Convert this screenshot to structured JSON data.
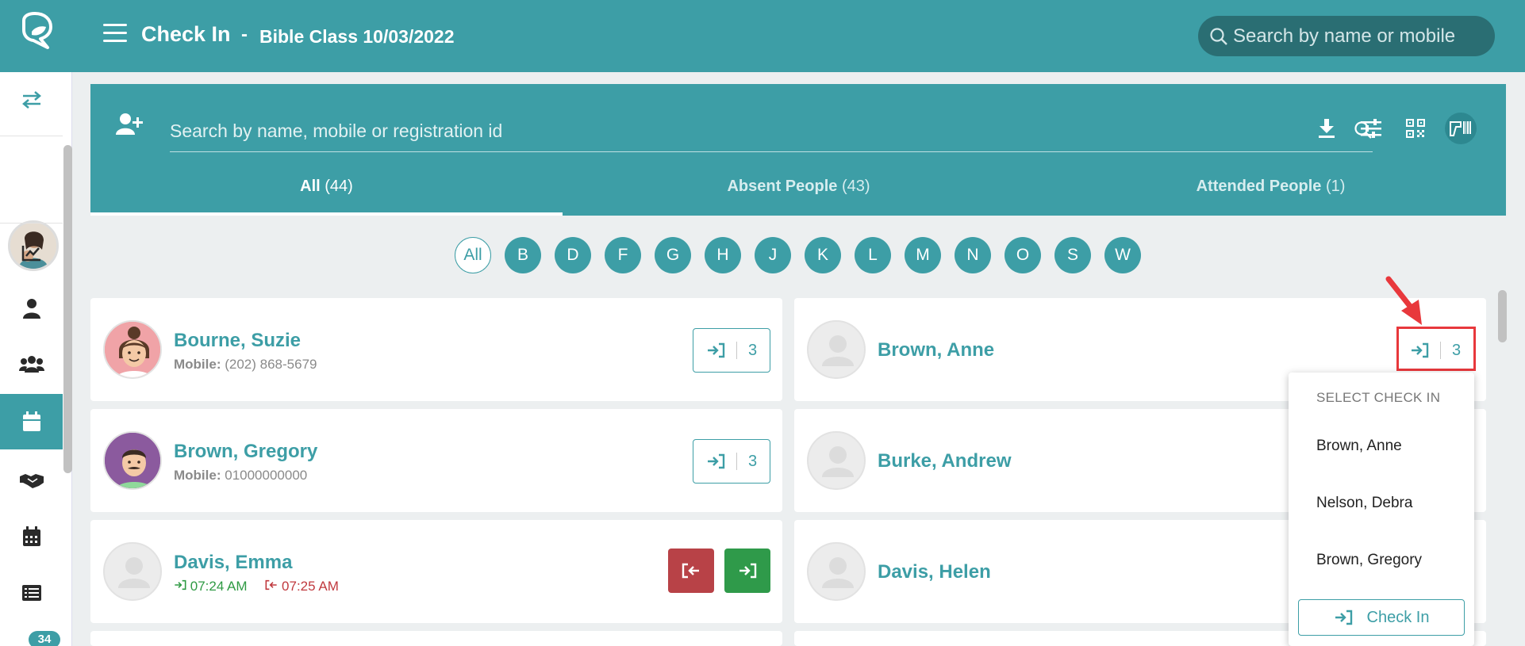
{
  "header": {
    "title": "Check In",
    "separator": "-",
    "subtitle": "Bible Class 10/03/2022",
    "search_placeholder": "Search by name or mobile"
  },
  "sidebar": {
    "items": [
      {
        "name": "swap-icon"
      },
      {
        "name": "chart-icon"
      },
      {
        "name": "person-icon"
      },
      {
        "name": "group-icon"
      },
      {
        "name": "calendar-icon",
        "active": true
      },
      {
        "name": "handshake-icon"
      },
      {
        "name": "events-calendar-icon"
      },
      {
        "name": "list-icon"
      }
    ],
    "badge": "34"
  },
  "panel": {
    "search_placeholder": "Search by name, mobile or registration id",
    "tabs": [
      {
        "label": "All",
        "count": "(44)",
        "active": true
      },
      {
        "label": "Absent People",
        "count": "(43)"
      },
      {
        "label": "Attended People",
        "count": "(1)"
      }
    ]
  },
  "letters": [
    "All",
    "B",
    "D",
    "F",
    "G",
    "H",
    "J",
    "K",
    "L",
    "M",
    "N",
    "O",
    "S",
    "W"
  ],
  "people": [
    {
      "name": "Bourne, Suzie",
      "mobile_label": "Mobile:",
      "mobile": "(202) 868-5679",
      "count": "3"
    },
    {
      "name": "Brown, Anne",
      "count": "3"
    },
    {
      "name": "Brown, Gregory",
      "mobile_label": "Mobile:",
      "mobile": "01000000000",
      "count": "3"
    },
    {
      "name": "Burke, Andrew"
    },
    {
      "name": "Davis, Emma",
      "time_in": "07:24 AM",
      "time_out": "07:25 AM"
    },
    {
      "name": "Davis, Helen"
    }
  ],
  "dropdown": {
    "header": "SELECT CHECK IN",
    "options": [
      "Brown, Anne",
      "Nelson, Debra",
      "Brown, Gregory"
    ],
    "button": "Check In"
  },
  "colors": {
    "primary": "#3d9ea6",
    "dark": "#2a6e73",
    "red": "#b84247",
    "green": "#2f9a4a",
    "highlight": "#e8383c"
  }
}
